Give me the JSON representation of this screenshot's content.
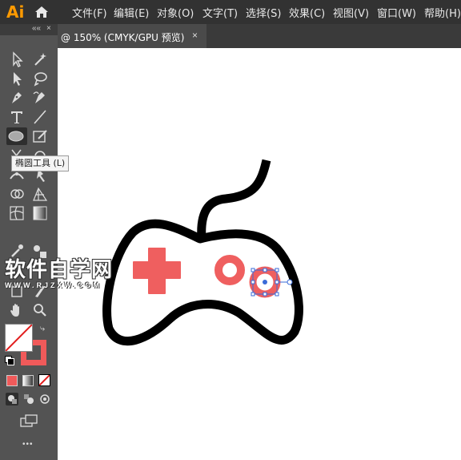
{
  "app": {
    "logo_text": "Ai"
  },
  "menu": {
    "items": [
      "文件(F)",
      "编辑(E)",
      "对象(O)",
      "文字(T)",
      "选择(S)",
      "效果(C)",
      "视图(V)",
      "窗口(W)",
      "帮助(H)"
    ]
  },
  "document_tab": {
    "title": "@ 150% (CMYK/GPU 预览)",
    "close": "×"
  },
  "toolbox": {
    "collapse_glyph": "««",
    "close_glyph": "×",
    "tooltip": "椭圆工具 (L)",
    "more_glyph": "•••"
  },
  "watermark": {
    "main": "软件自学网",
    "sub": "WWW.RJZXW.COM"
  },
  "colors": {
    "fill": "#ffffff",
    "stroke": "#f05a5a",
    "accent_red": "#ef5f5f",
    "ui_dark": "#323232",
    "toolbox_bg": "#535353"
  }
}
